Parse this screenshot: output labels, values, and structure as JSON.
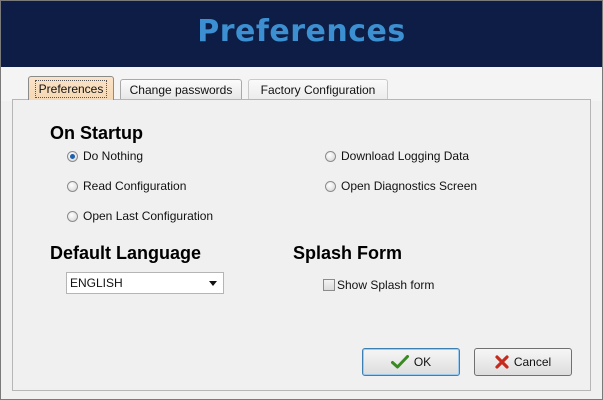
{
  "header": {
    "title": "Preferences"
  },
  "tabs": [
    {
      "label": "Preferences",
      "active": true
    },
    {
      "label": "Change passwords",
      "active": false
    },
    {
      "label": "Factory Configuration",
      "active": false
    }
  ],
  "startup": {
    "title": "On Startup",
    "options": [
      {
        "label": "Do Nothing",
        "checked": true
      },
      {
        "label": "Read Configuration",
        "checked": false
      },
      {
        "label": "Open Last Configuration",
        "checked": false
      },
      {
        "label": "Download Logging Data",
        "checked": false
      },
      {
        "label": "Open Diagnostics Screen",
        "checked": false
      }
    ]
  },
  "language": {
    "title": "Default Language",
    "value": "ENGLISH"
  },
  "splash": {
    "title": "Splash Form",
    "checkbox_label": "Show Splash form",
    "checked": false
  },
  "buttons": {
    "ok": "OK",
    "cancel": "Cancel"
  },
  "colors": {
    "header_bg": "#0d1d45",
    "header_text": "#3c8fd0",
    "radio_selected": "#1e5fae",
    "ok_check": "#3a8a22",
    "cancel_x": "#c42b1c"
  }
}
